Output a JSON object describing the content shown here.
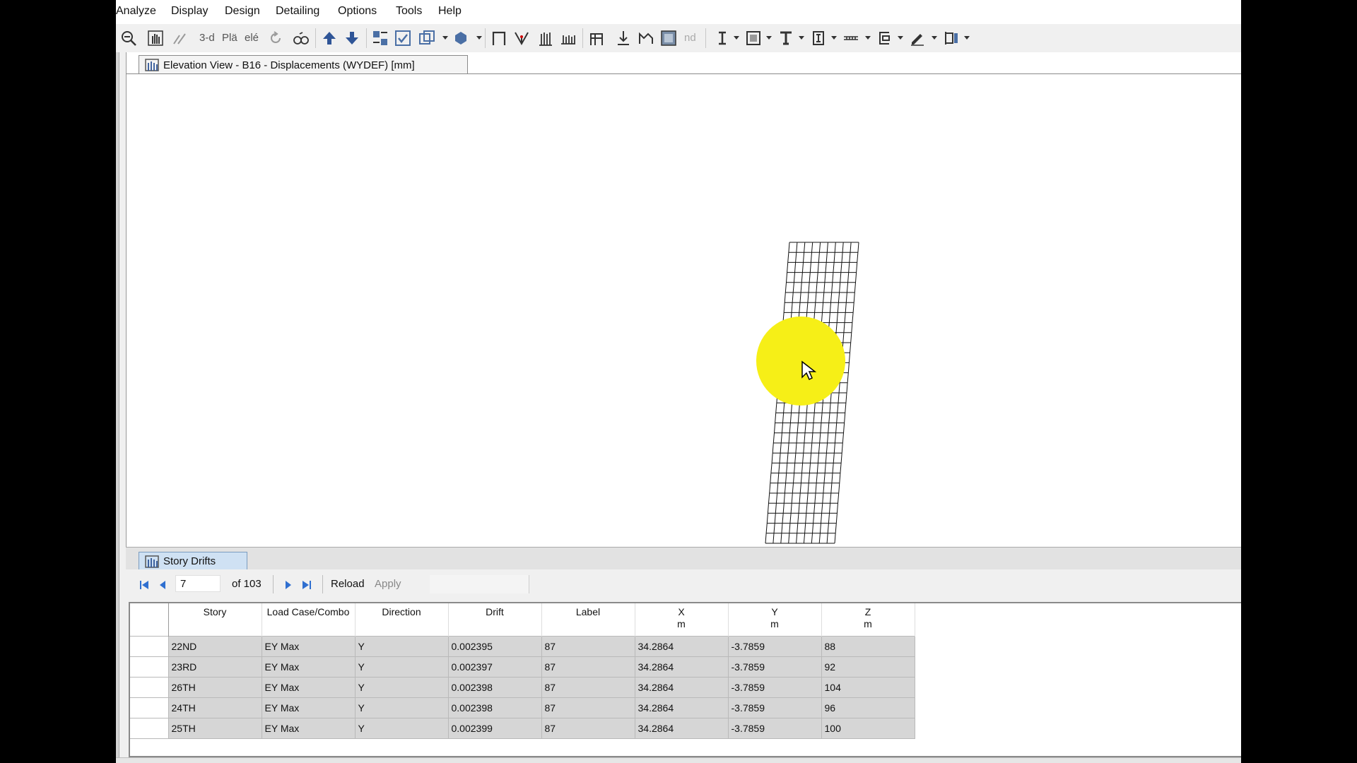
{
  "menu": [
    "Analyze",
    "Display",
    "Design",
    "Detailing",
    "Options",
    "Tools",
    "Help"
  ],
  "toolbar": {
    "icons": [
      "zoom-out-icon",
      "pan-icon",
      "rubber-band-icon",
      "view-3d-icon",
      "plan-view-icon",
      "elevation-view-icon",
      "rotate-icon",
      "perspective-icon",
      "move-up-icon",
      "move-down-icon",
      "select-objects-icon",
      "check-icon",
      "intersect-icon",
      "object-shrink-icon",
      "frame-icon",
      "brace-icon",
      "wall-icon",
      "floor-grid-icon",
      "portal-frame-icon",
      "point-load-icon",
      "section-cut-icon",
      "fill-icon",
      "beam-icon",
      "shell-icon",
      "column-icon",
      "i-section-icon",
      "ruler-icon",
      "link-icon",
      "draw-pen-icon",
      "column-frame-icon"
    ],
    "labels": {
      "view_3d": "3-d",
      "plan": "Plä",
      "elev": "elé",
      "nd": "nd"
    }
  },
  "elevation_tab": {
    "title": "Elevation View - B16  - Displacements (WYDEF)  [mm]"
  },
  "drift_tab": {
    "title": "Story Drifts"
  },
  "navigator": {
    "current": "7",
    "of_label": "of 103",
    "reload": "Reload",
    "apply": "Apply"
  },
  "table": {
    "columns": [
      {
        "name": "Story",
        "unit": ""
      },
      {
        "name": "Load Case/Combo",
        "unit": ""
      },
      {
        "name": "Direction",
        "unit": ""
      },
      {
        "name": "Drift",
        "unit": ""
      },
      {
        "name": "Label",
        "unit": ""
      },
      {
        "name": "X",
        "unit": "m"
      },
      {
        "name": "Y",
        "unit": "m"
      },
      {
        "name": "Z",
        "unit": "m"
      }
    ],
    "rows": [
      [
        "22ND",
        "EY Max",
        "Y",
        "0.002395",
        "87",
        "34.2864",
        "-3.7859",
        "88"
      ],
      [
        "23RD",
        "EY Max",
        "Y",
        "0.002397",
        "87",
        "34.2864",
        "-3.7859",
        "92"
      ],
      [
        "26TH",
        "EY Max",
        "Y",
        "0.002398",
        "87",
        "34.2864",
        "-3.7859",
        "104"
      ],
      [
        "24TH",
        "EY Max",
        "Y",
        "0.002398",
        "87",
        "34.2864",
        "-3.7859",
        "96"
      ],
      [
        "25TH",
        "EY Max",
        "Y",
        "0.002399",
        "87",
        "34.2864",
        "-3.7859",
        "100"
      ]
    ]
  },
  "colors": {
    "cursor_highlight": "#f6ef17",
    "active_tab": "#cfe1f3",
    "row_bg": "#d6d6d6"
  }
}
